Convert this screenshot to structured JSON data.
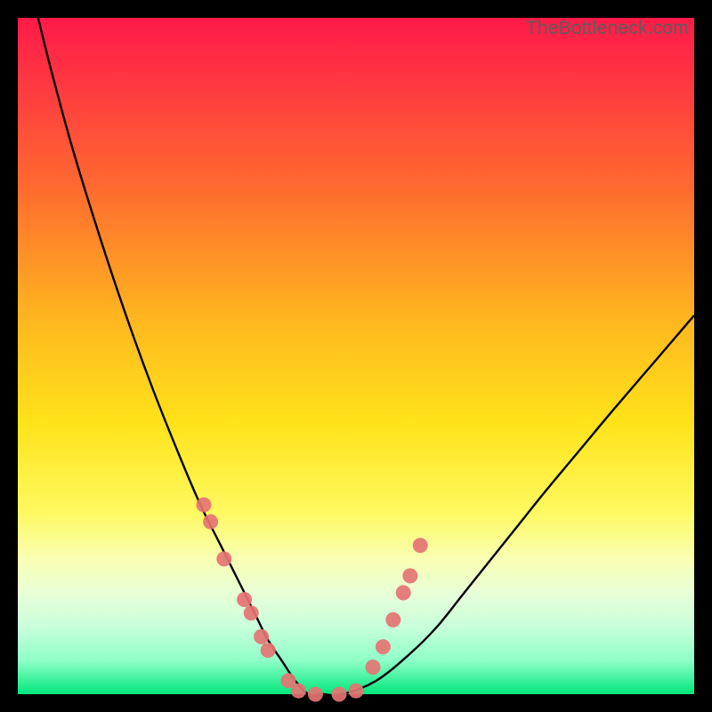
{
  "watermark": "TheBottleneck.com",
  "colors": {
    "dot": "#e57373",
    "curve": "#000000",
    "frame": "#000000"
  },
  "chart_data": {
    "type": "line",
    "title": "",
    "xlabel": "",
    "ylabel": "",
    "xlim": [
      0,
      100
    ],
    "ylim": [
      0,
      100
    ],
    "grid": false,
    "legend": false,
    "series": [
      {
        "name": "bottleneck-curve",
        "x": [
          3,
          5,
          8,
          12,
          16,
          20,
          24,
          27,
          30,
          33,
          35,
          37,
          39,
          41,
          43,
          45,
          48,
          53,
          58,
          62,
          66,
          70,
          74,
          78,
          83,
          88,
          94,
          100
        ],
        "y": [
          100,
          92,
          81,
          68,
          56,
          45,
          35,
          28,
          22,
          16,
          12,
          8,
          5,
          2,
          0,
          0,
          0,
          2,
          6,
          10,
          15,
          20,
          25,
          30,
          36,
          42,
          49,
          56
        ]
      }
    ],
    "dots": {
      "name": "highlight-markers",
      "x": [
        27.5,
        28.5,
        30.5,
        33.5,
        34.5,
        36.0,
        37.0,
        40.0,
        41.5,
        44.0,
        47.5,
        50.0,
        52.5,
        54.0,
        55.5,
        57.0,
        58.0,
        59.5
      ],
      "y": [
        28.0,
        25.5,
        20.0,
        14.0,
        12.0,
        8.5,
        6.5,
        2.0,
        0.5,
        0.0,
        0.0,
        0.5,
        4.0,
        7.0,
        11.0,
        15.0,
        17.5,
        22.0
      ]
    }
  }
}
